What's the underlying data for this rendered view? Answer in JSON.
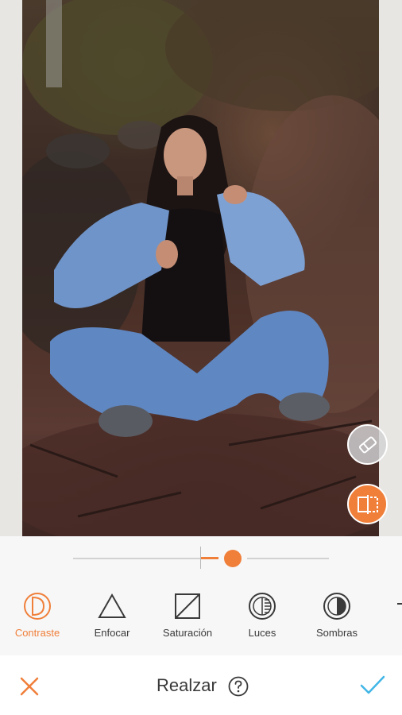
{
  "screen": {
    "title": "Realzar"
  },
  "slider": {
    "value_fraction": 0.125
  },
  "tools": [
    {
      "label": "Contraste",
      "icon": "contrast-icon",
      "active": true
    },
    {
      "label": "Enfocar",
      "icon": "triangle-sharpen-icon",
      "active": false
    },
    {
      "label": "Saturación",
      "icon": "saturation-icon",
      "active": false
    },
    {
      "label": "Luces",
      "icon": "highlights-icon",
      "active": false
    },
    {
      "label": "Sombras",
      "icon": "shadows-icon",
      "active": false
    }
  ],
  "floating": {
    "eraser": "eraser-icon",
    "compare": "compare-icon"
  },
  "colors": {
    "accent": "#f07f3a",
    "done": "#41b6e6",
    "text": "#3a3a3a"
  }
}
